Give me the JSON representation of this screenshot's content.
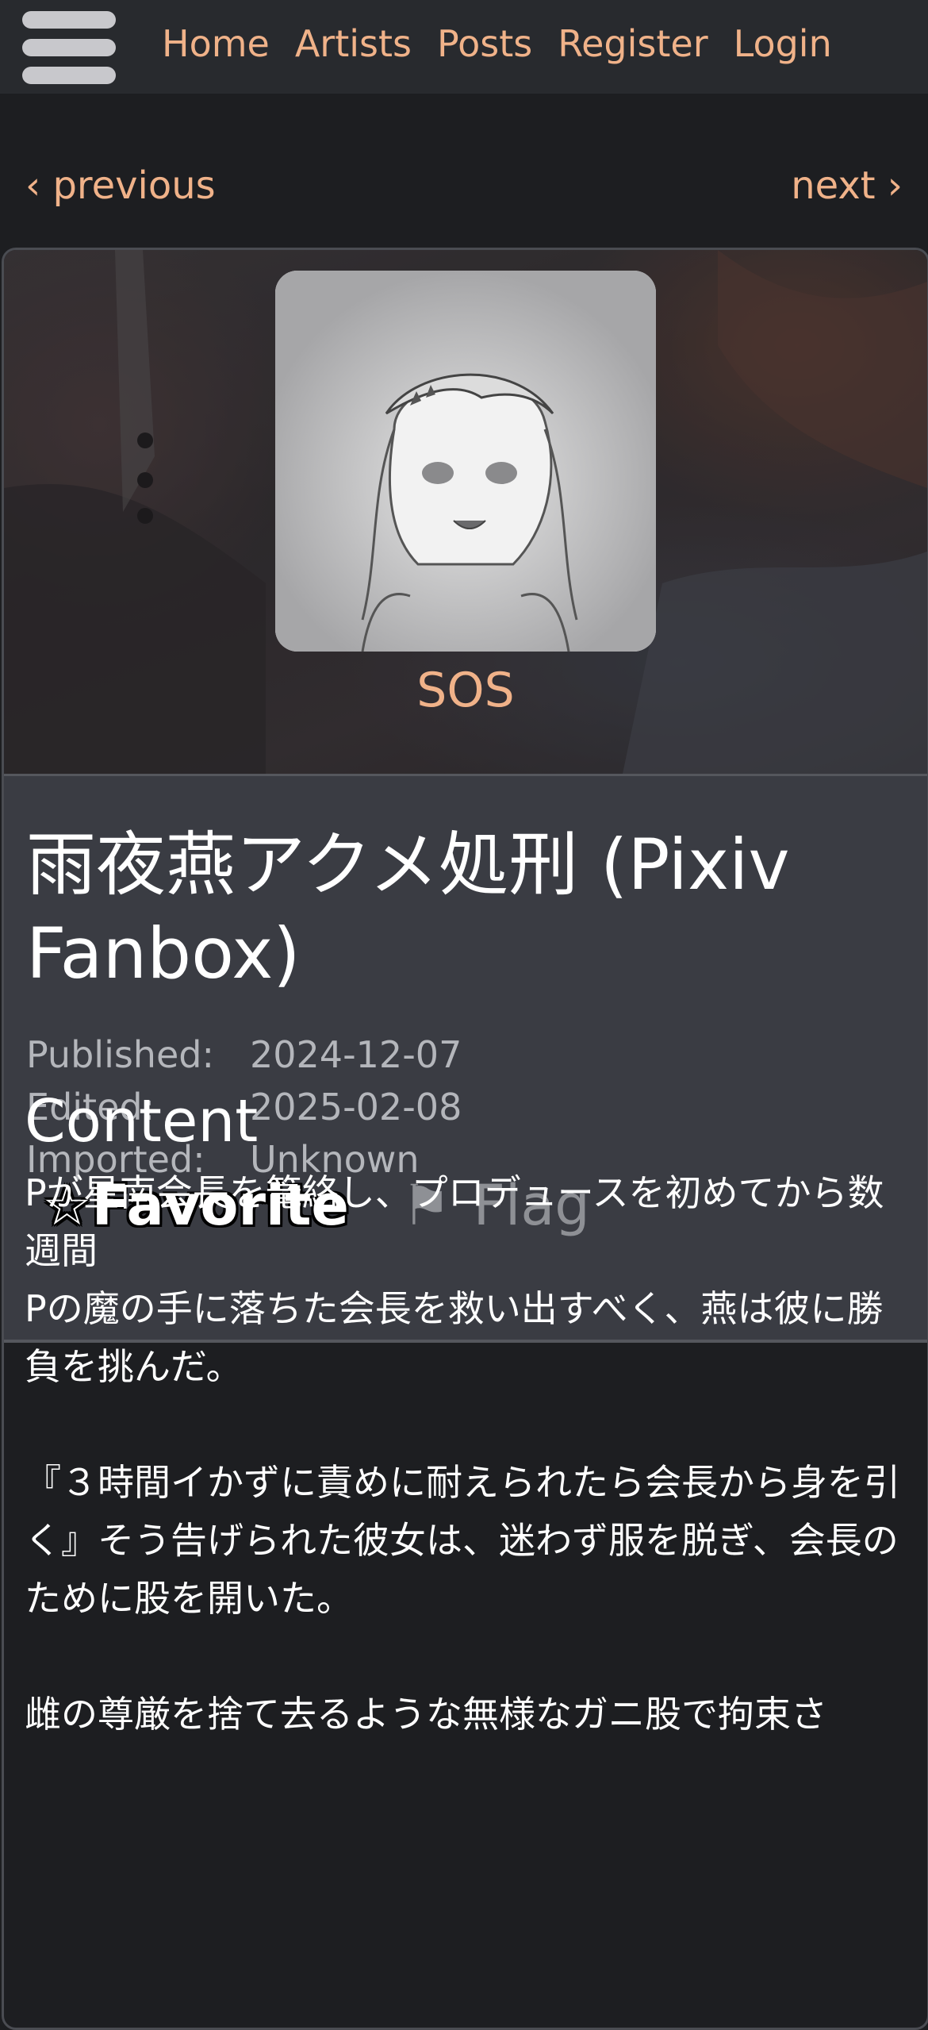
{
  "nav": {
    "menu_icon": "hamburger-menu-icon",
    "links": [
      "Home",
      "Artists",
      "Posts",
      "Register",
      "Login"
    ],
    "accent_color": "#f0b289"
  },
  "pager": {
    "previous": "‹ previous",
    "next": "next ›"
  },
  "artist": {
    "name": "SOS"
  },
  "post": {
    "title": "雨夜燕アクメ処刑 (Pixiv Fanbox)",
    "meta": {
      "published_label": "Published:",
      "published_value": "2024-12-07",
      "edited_label": "Edited:",
      "edited_value": "2025-02-08",
      "imported_label": "Imported:",
      "imported_value": "Unknown"
    },
    "actions": {
      "favorite_icon": "☆",
      "favorite_label": "Favorite",
      "flag_icon": "⚑",
      "flag_label": "Flag"
    }
  },
  "content": {
    "heading": "Content",
    "body": "Pが星南会長を篭絡し、プロデュースを初めてから数週間\nPの魔の手に落ちた会長を救い出すべく、燕は彼に勝負を挑んだ。\n\n『３時間イかずに責めに耐えられたら会長から身を引く』そう告げられた彼女は、迷わず服を脱ぎ、会長のために股を開いた。\n\n雌の尊厳を捨て去るような無様なガニ股で拘束さ"
  }
}
